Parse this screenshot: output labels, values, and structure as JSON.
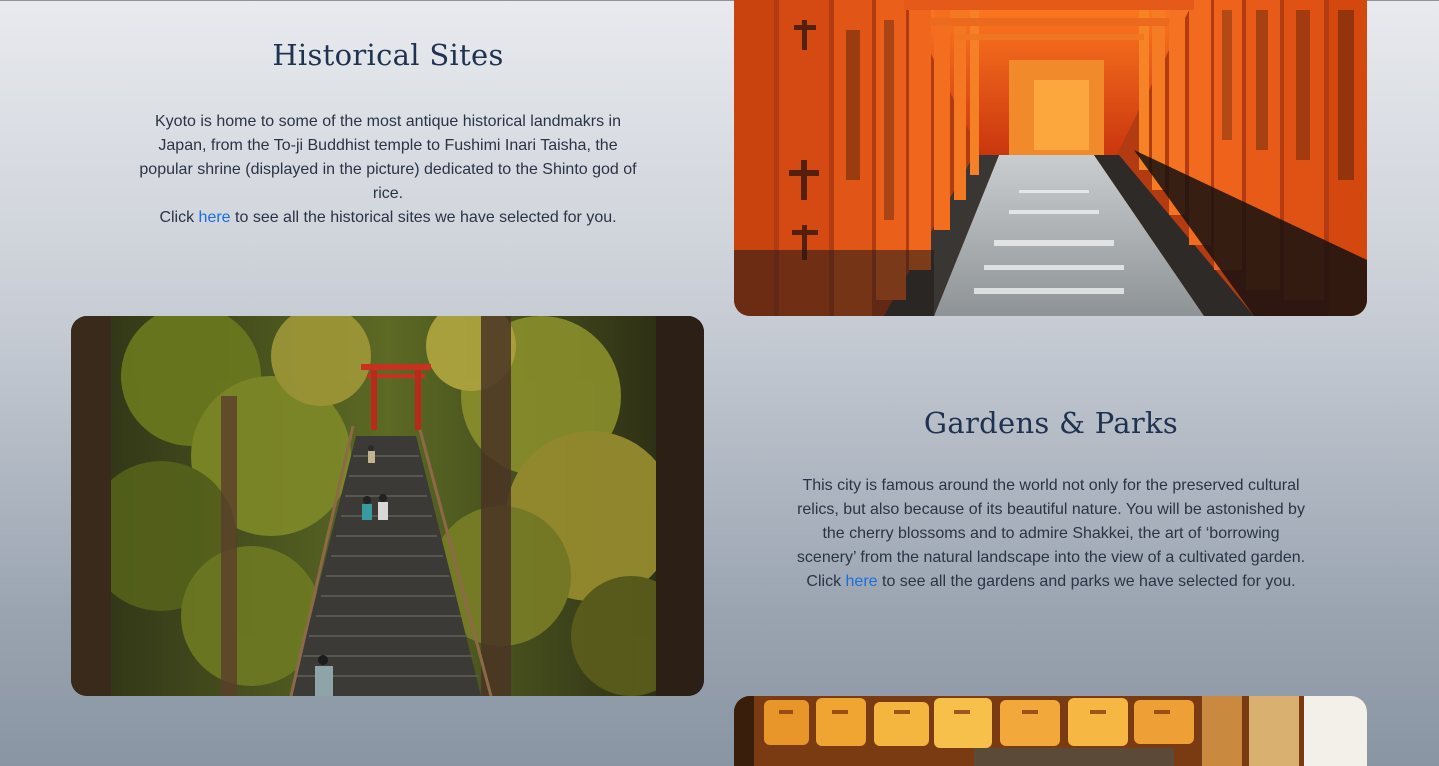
{
  "historical": {
    "title": "Historical Sites",
    "paragraph": "Kyoto is home to some of the most antique historical landmakrs in Japan, from the To-ji Buddhist temple to Fushimi Inari Taisha, the popular shrine (displayed in the picture) dedicated to the Shinto god of rice.",
    "cta_prefix": "Click ",
    "cta_link": "here",
    "cta_suffix": " to see all the historical sites we have selected for you."
  },
  "gardens": {
    "title": "Gardens & Parks",
    "paragraph": "This city is famous around the world not only for the preserved cultural relics, but also because of its beautiful nature. You will be astonished by the cherry blossoms and to admire Shakkei, the art of ‘borrowing scenery’ from the natural landscape into the view of a cultivated garden.",
    "cta_prefix": "Click ",
    "cta_link": "here",
    "cta_suffix": " to see all the gardens and parks we have selected for you."
  },
  "images": {
    "torii": "fushimi-inari-torii-gates-photo",
    "stairs": "forest-shrine-stairs-photo",
    "lanterns": "lantern-street-photo"
  },
  "colors": {
    "heading": "#1f3350",
    "body_text": "#2b3445",
    "link": "#1a6fe0",
    "torii_orange": "#e2501a"
  }
}
